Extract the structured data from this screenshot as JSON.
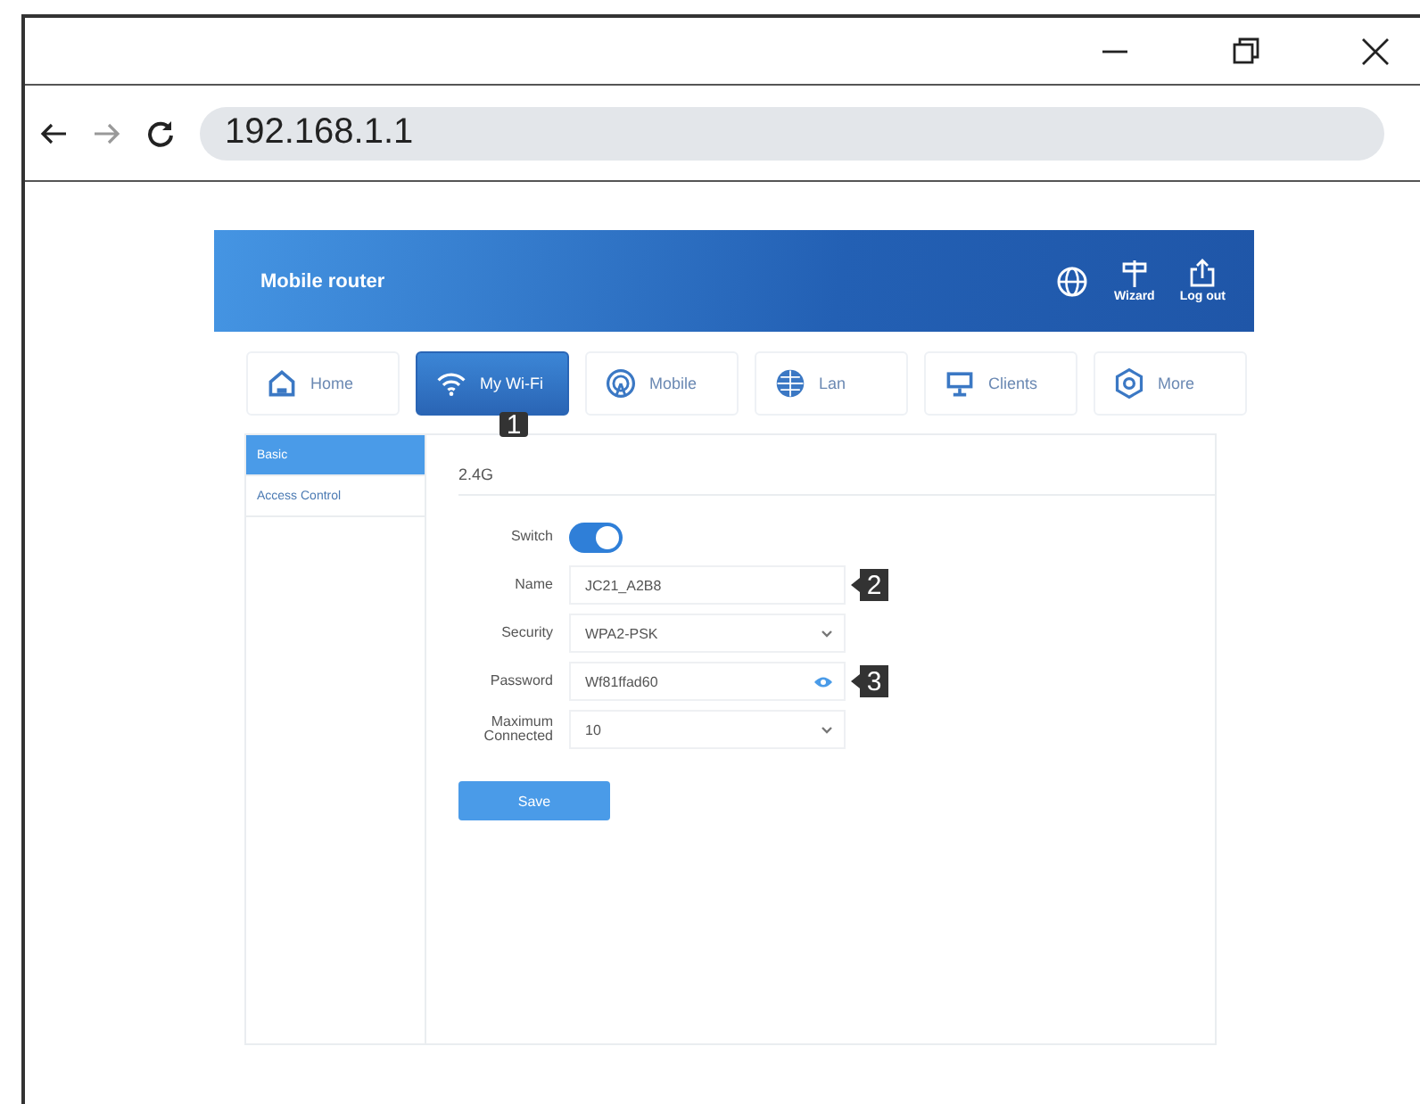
{
  "browser": {
    "address": "192.168.1.1"
  },
  "app": {
    "title": "Mobile router",
    "header_actions": [
      {
        "kind": "language"
      },
      {
        "kind": "wizard",
        "label": "Wizard"
      },
      {
        "kind": "logout",
        "label": "Log out"
      }
    ],
    "tabs": [
      {
        "kind": "home",
        "label": "Home",
        "selected": false
      },
      {
        "kind": "wifi",
        "label": "My Wi-Fi",
        "selected": true
      },
      {
        "kind": "mobile",
        "label": "Mobile",
        "selected": false
      },
      {
        "kind": "lan",
        "label": "Lan",
        "selected": false
      },
      {
        "kind": "clients",
        "label": "Clients",
        "selected": false
      },
      {
        "kind": "more",
        "label": "More",
        "selected": false
      }
    ],
    "sidebar": {
      "items": [
        {
          "label": "Basic",
          "selected": true
        },
        {
          "label": "Access Control",
          "selected": false
        }
      ]
    },
    "section_title": "2.4G",
    "form": [
      {
        "kind": "switch",
        "label": "Switch",
        "on": true
      },
      {
        "kind": "text",
        "label": "Name",
        "value": "JC21_A2B8",
        "callout": "2"
      },
      {
        "kind": "select",
        "label": "Security",
        "value": "WPA2-PSK"
      },
      {
        "kind": "password",
        "label": "Password",
        "value": "Wf81ffad60",
        "callout": "3"
      },
      {
        "kind": "select",
        "label": "Maximum Connected",
        "value": "10"
      }
    ],
    "save_button": "Save",
    "tab_callout": "1"
  }
}
